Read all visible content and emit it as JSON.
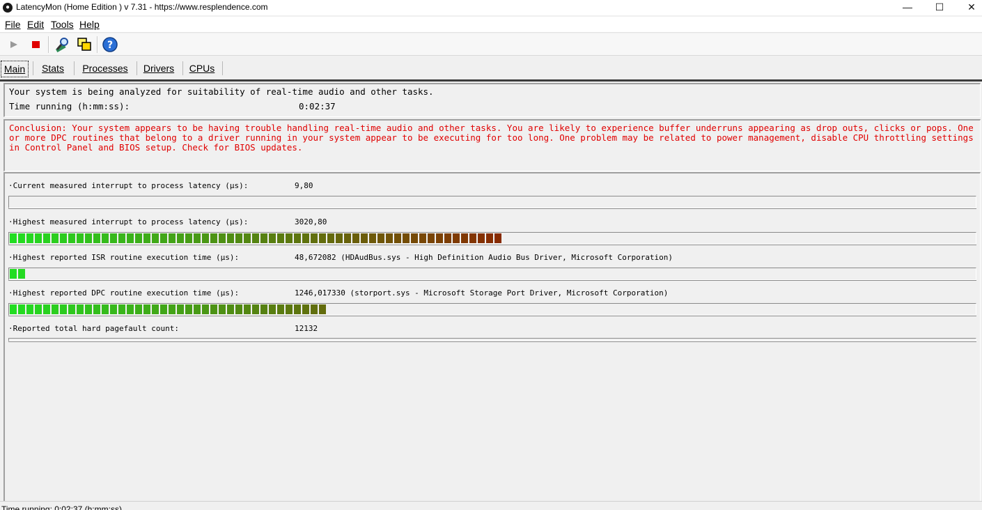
{
  "window": {
    "title": "LatencyMon  (Home Edition )  v 7.31 - https://www.resplendence.com",
    "controls": {
      "minimize": "—",
      "maximize": "☐",
      "close": "✕"
    }
  },
  "menu": [
    {
      "label": "File"
    },
    {
      "label": "Edit"
    },
    {
      "label": "Tools"
    },
    {
      "label": "Help"
    }
  ],
  "toolbar": {
    "icons": [
      "play-icon",
      "stop-icon",
      "magnifier-icon",
      "windows-icon",
      "help-icon"
    ]
  },
  "tabs": [
    {
      "label": "Main",
      "active": true
    },
    {
      "label": "Stats",
      "active": false
    },
    {
      "label": "Processes",
      "active": false
    },
    {
      "label": "Drivers",
      "active": false
    },
    {
      "label": "CPUs",
      "active": false
    }
  ],
  "summary": {
    "headline": "Your system is being analyzed for suitability of real-time audio and other tasks.",
    "time_label": "Time running (h:mm:ss):",
    "time_value": "0:02:37"
  },
  "conclusion": "Conclusion: Your system appears to be having trouble handling real-time audio and other tasks. You are likely to experience buffer underruns appearing as drop outs, clicks or pops. One or more DPC routines that belong to a driver running in your system appear to be executing for too long. One problem may be related to power management, disable CPU throttling settings in Control Panel and BIOS setup. Check for BIOS updates.",
  "metrics": [
    {
      "label": "·Current measured interrupt to process latency (µs):",
      "value": "9,80",
      "fraction": 0.0
    },
    {
      "label": "·Highest measured interrupt to process latency (µs):",
      "value": "3020,80",
      "fraction": 0.518
    },
    {
      "label": "·Highest reported ISR routine execution time (µs):",
      "value": "48,672082  (HDAudBus.sys - High Definition Audio Bus Driver, Microsoft Corporation)",
      "fraction": 0.017
    },
    {
      "label": "·Highest reported DPC routine execution time (µs):",
      "value": "1246,017330  (storport.sys - Microsoft Storage Port Driver, Microsoft Corporation)",
      "fraction": 0.336
    },
    {
      "label": "·Reported total hard pagefault count:",
      "value": "12132",
      "fraction": 0.0
    }
  ],
  "colors": {
    "conclusion_text": "#e00000",
    "bar_start": "#22dd22",
    "bar_end": "#8b2500"
  },
  "status": {
    "text": "Time running: 0:02:37  (h:mm:ss)"
  }
}
